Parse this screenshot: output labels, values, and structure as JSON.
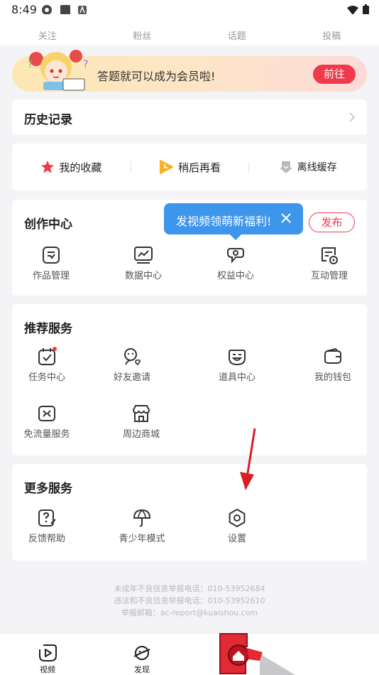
{
  "status_bar": {
    "time": "8:49"
  },
  "stats": [
    {
      "label": "关注"
    },
    {
      "label": "粉丝"
    },
    {
      "label": "话题"
    },
    {
      "label": "投稿"
    }
  ],
  "banner": {
    "text": "答题就可以成为会员啦!",
    "button": "前往"
  },
  "history": {
    "title": "历史记录"
  },
  "quick": [
    {
      "label": "我的收藏",
      "icon": "star-icon"
    },
    {
      "label": "稍后再看",
      "icon": "watch-later-icon"
    },
    {
      "label": "离线缓存",
      "icon": "download-icon"
    }
  ],
  "create_center": {
    "title": "创作中心",
    "publish": "发布",
    "tooltip": "发视频领萌新福利!",
    "items": [
      {
        "label": "作品管理",
        "icon": "works-icon"
      },
      {
        "label": "数据中心",
        "icon": "chart-icon"
      },
      {
        "label": "权益中心",
        "icon": "rights-icon"
      },
      {
        "label": "互动管理",
        "icon": "interaction-icon"
      }
    ]
  },
  "recommend": {
    "title": "推荐服务",
    "items": [
      {
        "label": "任务中心",
        "icon": "task-icon"
      },
      {
        "label": "好友邀请",
        "icon": "invite-icon"
      },
      {
        "label": "道具中心",
        "icon": "props-icon"
      },
      {
        "label": "我的钱包",
        "icon": "wallet-icon"
      },
      {
        "label": "免流量服务",
        "icon": "data-free-icon"
      },
      {
        "label": "周边商城",
        "icon": "shop-icon"
      }
    ]
  },
  "more": {
    "title": "更多服务",
    "items": [
      {
        "label": "反馈帮助",
        "icon": "feedback-icon"
      },
      {
        "label": "青少年模式",
        "icon": "umbrella-icon"
      },
      {
        "label": "设置",
        "icon": "settings-icon"
      }
    ]
  },
  "footer": {
    "line1": "未成年不良信息举报电话：010-53952684",
    "line2": "违法和不良信息举报电话：010-53952610",
    "line3": "举报邮箱：ac-report@kuaishou.com"
  },
  "tabbar": [
    {
      "label": "视频",
      "icon": "video-tab-icon"
    },
    {
      "label": "发现",
      "icon": "discover-tab-icon"
    }
  ],
  "colors": {
    "accent": "#f0394b",
    "tooltip": "#3e95ec",
    "background": "#f4f4f6"
  }
}
